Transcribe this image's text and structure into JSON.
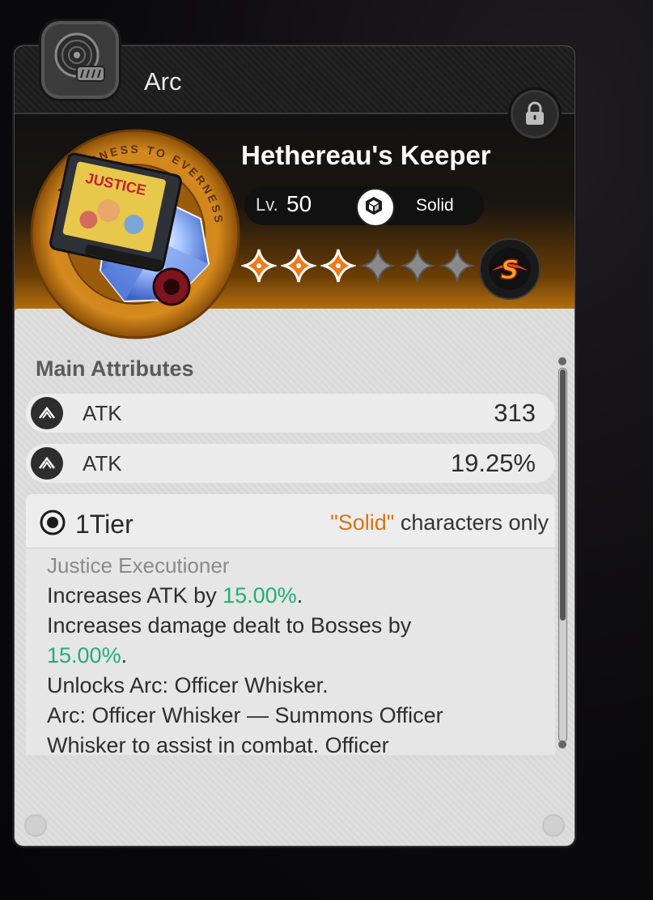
{
  "header": {
    "title": "Arc"
  },
  "item": {
    "name": "Hethereau's Keeper",
    "level_prefix": "Lv.",
    "level": "50",
    "element": "Solid",
    "stars_filled": 3,
    "stars_total": 6,
    "rank_letter": "S"
  },
  "medal": {
    "ring_text": "NEVERNESS TO EVERNESS",
    "card_art_text": "JUSTICE"
  },
  "main_attributes": {
    "title": "Main Attributes",
    "rows": [
      {
        "name": "ATK",
        "value": "313"
      },
      {
        "name": "ATK",
        "value": "19.25%"
      }
    ]
  },
  "tier": {
    "label": "1Tier",
    "requirement_highlight": "\"Solid\"",
    "requirement_rest": " characters only",
    "effect_name": "Justice Executioner",
    "lines": {
      "l1_pre": "Increases ATK by ",
      "l1_val": "15.00%",
      "l1_post": ".",
      "l2_pre": "Increases damage dealt to Bosses by",
      "l2_val": "15.00%",
      "l2_post": ".",
      "l3": "Unlocks Arc: Officer Whisker.",
      "l4": "Arc: Officer Whisker — Summons Officer",
      "l5": "Whisker to assist in combat. Officer"
    }
  },
  "colors": {
    "accent_orange": "#d9750e",
    "highlight_green": "#1fae7a",
    "star_filled": "#f07a1a",
    "star_empty": "#8a8a8a"
  },
  "icons": {
    "type_badge": "disc-icon",
    "lock": "lock-icon",
    "element": "solid-element-icon",
    "rank": "s-rank-icon",
    "attribute": "atk-icon",
    "tier": "target-icon"
  }
}
